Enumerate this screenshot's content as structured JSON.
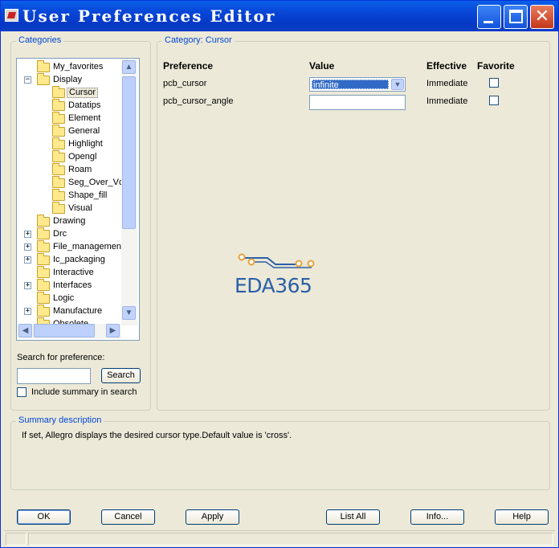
{
  "window": {
    "title": "User Preferences Editor"
  },
  "categories": {
    "group_label": "Categories",
    "tree": [
      {
        "label": "My_favorites",
        "level": 0,
        "expander": ""
      },
      {
        "label": "Display",
        "level": 0,
        "expander": "−"
      },
      {
        "label": "Cursor",
        "level": 1,
        "expander": "",
        "selected": true
      },
      {
        "label": "Datatips",
        "level": 1,
        "expander": ""
      },
      {
        "label": "Element",
        "level": 1,
        "expander": ""
      },
      {
        "label": "General",
        "level": 1,
        "expander": ""
      },
      {
        "label": "Highlight",
        "level": 1,
        "expander": ""
      },
      {
        "label": "Opengl",
        "level": 1,
        "expander": ""
      },
      {
        "label": "Roam",
        "level": 1,
        "expander": ""
      },
      {
        "label": "Seg_Over_Vc",
        "level": 1,
        "expander": ""
      },
      {
        "label": "Shape_fill",
        "level": 1,
        "expander": ""
      },
      {
        "label": "Visual",
        "level": 1,
        "expander": ""
      },
      {
        "label": "Drawing",
        "level": 0,
        "expander": ""
      },
      {
        "label": "Drc",
        "level": 0,
        "expander": "+"
      },
      {
        "label": "File_management",
        "level": 0,
        "expander": "+"
      },
      {
        "label": "Ic_packaging",
        "level": 0,
        "expander": "+"
      },
      {
        "label": "Interactive",
        "level": 0,
        "expander": ""
      },
      {
        "label": "Interfaces",
        "level": 0,
        "expander": "+"
      },
      {
        "label": "Logic",
        "level": 0,
        "expander": ""
      },
      {
        "label": "Manufacture",
        "level": 0,
        "expander": "+"
      },
      {
        "label": "Obsolete",
        "level": 0,
        "expander": ""
      }
    ],
    "search_label": "Search for preference:",
    "search_value": "",
    "search_button": "Search",
    "include_summary_label": "Include summary in search"
  },
  "category_panel": {
    "group_label_prefix": "Category:",
    "group_label_value": "Cursor",
    "headers": {
      "preference": "Preference",
      "value": "Value",
      "effective": "Effective",
      "favorite": "Favorite"
    },
    "rows": [
      {
        "name": "pcb_cursor",
        "value": "infinite",
        "effective": "Immediate",
        "favorite": false
      },
      {
        "name": "pcb_cursor_angle",
        "value": "",
        "effective": "Immediate",
        "favorite": false
      }
    ]
  },
  "watermark": {
    "text": "EDA365",
    "color": "#2a5fa8",
    "accent": "#e8a13a"
  },
  "summary": {
    "group_label": "Summary description",
    "text": "If set, Allegro displays the desired cursor type.Default value is 'cross'."
  },
  "buttons": {
    "ok": "OK",
    "cancel": "Cancel",
    "apply": "Apply",
    "list_all": "List All",
    "info": "Info...",
    "help": "Help"
  },
  "colors": {
    "titlebar": "#0845d6",
    "dialog_bg": "#ece9d8",
    "group_label": "#0046d5",
    "selection": "#316ac5"
  }
}
